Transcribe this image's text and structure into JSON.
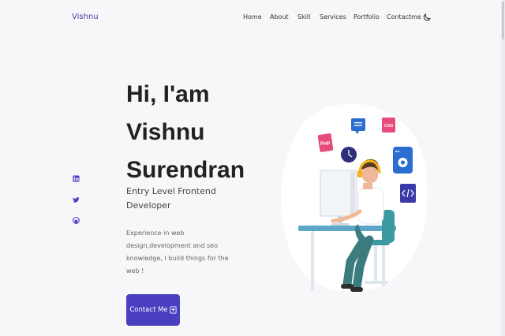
{
  "brand": "Vishnu",
  "nav": [
    "Home",
    "About",
    "Skill",
    "Services",
    "Portfolio",
    "Contactme"
  ],
  "hero": {
    "title": [
      "Hi, I'am",
      "Vishnu",
      "Surendran"
    ],
    "subtitle": [
      "Entry Level Frontend",
      "Developer"
    ],
    "description": [
      "Experience in web",
      "design,development and seo",
      "knowledge, I build things for the",
      "web !"
    ],
    "cta": "Contact Me"
  },
  "illustration_tags": [
    "PHP",
    "CSS"
  ],
  "icons": [
    "moon-icon",
    "linkedin-icon",
    "twitter-icon",
    "github-icon",
    "send-icon"
  ],
  "colors": {
    "accent": "#4a3fc0",
    "background": "#f7f7fa"
  }
}
